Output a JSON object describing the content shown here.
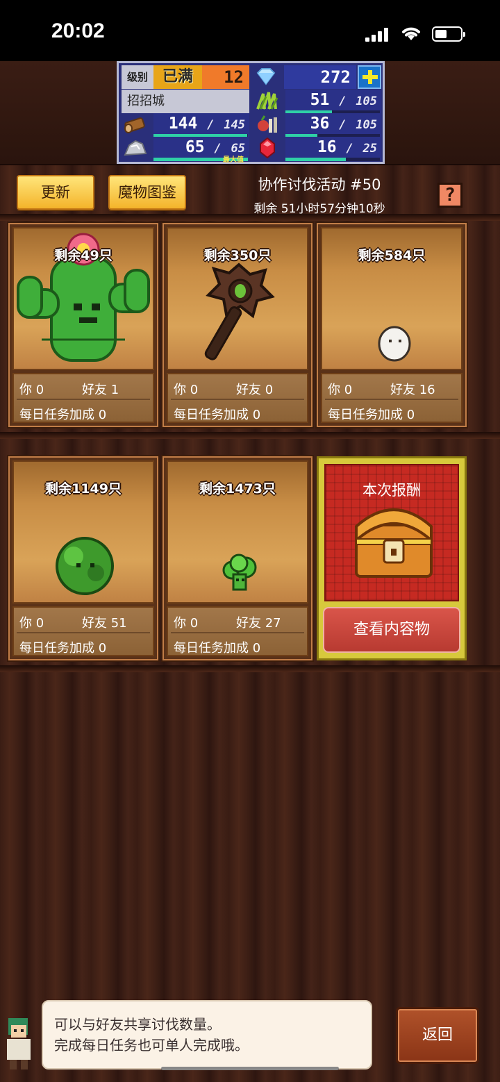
{
  "status_bar": {
    "time": "20:02"
  },
  "stats": {
    "level_label": "级别",
    "level_max": "已满",
    "level": "12",
    "gems": "272",
    "city_name": "招招城",
    "grass": "51",
    "grass_max": "105",
    "wood": "144",
    "wood_max": "145",
    "food": "36",
    "food_max": "105",
    "ore": "65",
    "ore_max": "65",
    "ore_max_tag": "最大值",
    "ruby": "16",
    "ruby_max": "25",
    "divider": "/"
  },
  "header": {
    "refresh_label": "更新",
    "bestiary_label": "魔物图鉴",
    "event_title": "协作讨伐活动 #50",
    "remaining_time": "剩余 51小时57分钟10秒",
    "help_label": "?"
  },
  "cards": [
    {
      "remaining": "剩余49只",
      "you": "你 0",
      "friends": "好友  1",
      "daily": "每日任务加成  0",
      "monster": "cactus"
    },
    {
      "remaining": "剩余350只",
      "you": "你 0",
      "friends": "好友  0",
      "daily": "每日任务加成  0",
      "monster": "staff"
    },
    {
      "remaining": "剩余584只",
      "you": "你 0",
      "friends": "好友  16",
      "daily": "每日任务加成  0",
      "monster": "egg"
    },
    {
      "remaining": "剩余1149只",
      "you": "你 0",
      "friends": "好友  51",
      "daily": "每日任务加成  0",
      "monster": "bush"
    },
    {
      "remaining": "剩余1473只",
      "you": "你 0",
      "friends": "好友  27",
      "daily": "每日任务加成  0",
      "monster": "broccoli"
    }
  ],
  "reward": {
    "title": "本次报酬",
    "view_label": "查看内容物"
  },
  "dialog": {
    "line1": "可以与好友共享讨伐数量。",
    "line2": "完成每日任务也可单人完成哦。"
  },
  "back_label": "返回",
  "colors": {
    "accent_gold": "#f4b42b",
    "reward_red": "#c62a22",
    "bar_green": "#2fd0a6"
  }
}
